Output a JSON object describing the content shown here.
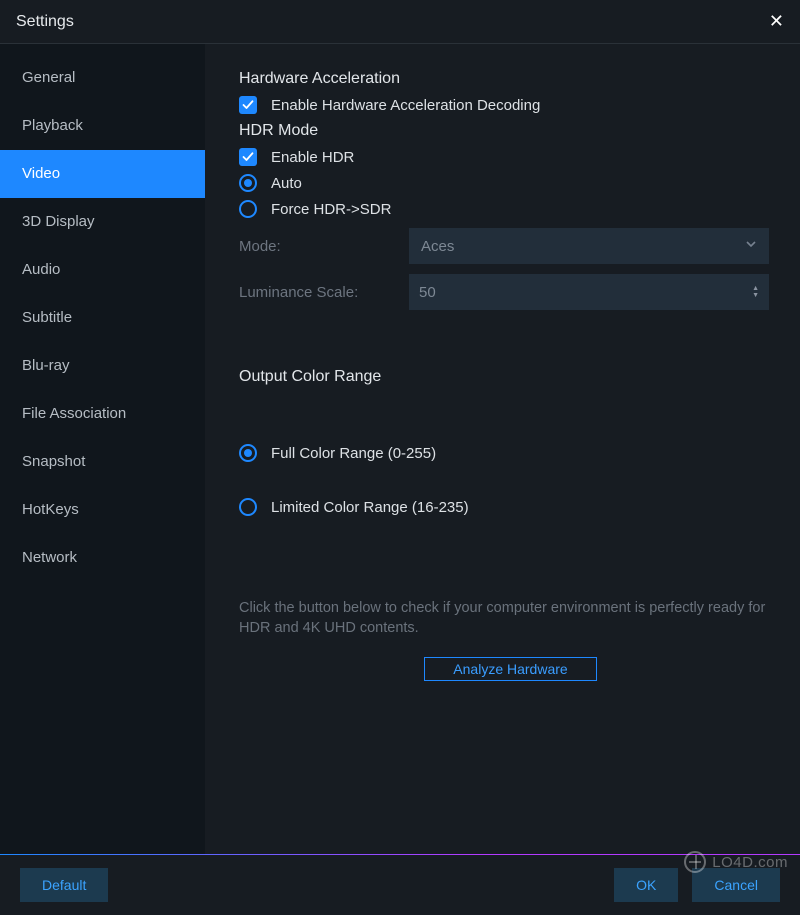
{
  "window": {
    "title": "Settings"
  },
  "sidebar": {
    "items": [
      {
        "label": "General"
      },
      {
        "label": "Playback"
      },
      {
        "label": "Video",
        "active": true
      },
      {
        "label": "3D Display"
      },
      {
        "label": "Audio"
      },
      {
        "label": "Subtitle"
      },
      {
        "label": "Blu-ray"
      },
      {
        "label": "File Association"
      },
      {
        "label": "Snapshot"
      },
      {
        "label": "HotKeys"
      },
      {
        "label": "Network"
      }
    ]
  },
  "video": {
    "hw_accel_title": "Hardware Acceleration",
    "hw_accel_enable": "Enable Hardware Acceleration Decoding",
    "hdr_title": "HDR Mode",
    "hdr_enable": "Enable HDR",
    "hdr_auto": "Auto",
    "hdr_force": "Force HDR->SDR",
    "mode_label": "Mode:",
    "mode_value": "Aces",
    "lum_label": "Luminance Scale:",
    "lum_value": "50",
    "ocr_title": "Output Color Range",
    "ocr_full": "Full Color Range (0-255)",
    "ocr_limited": "Limited Color Range (16-235)",
    "hint": "Click the button below to check if your computer environment is perfectly ready for HDR and 4K UHD contents.",
    "analyze": "Analyze Hardware"
  },
  "footer": {
    "default": "Default",
    "ok": "OK",
    "cancel": "Cancel"
  },
  "watermark": "LO4D.com"
}
